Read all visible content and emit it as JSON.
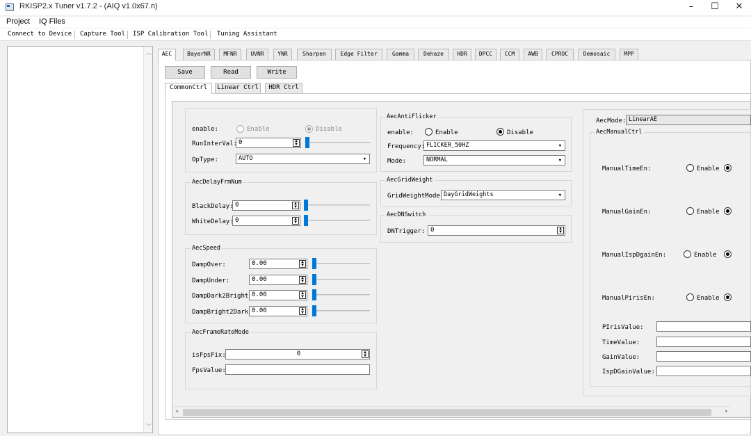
{
  "window": {
    "title": "RKISP2.x Tuner v1.7.2 - (AIQ v1.0x67.n)",
    "controls": [
      "–",
      "☐",
      "✕"
    ]
  },
  "menu": [
    "Project",
    "IQ Files"
  ],
  "toolbar": [
    "Connect to Device",
    "Capture Tool",
    "ISP Calibration Tool",
    "Tuning Assistant"
  ],
  "module_tabs": [
    "AEC",
    "BayerNR",
    "MFNR",
    "UVNR",
    "YNR",
    "Sharpen",
    "Edge Filter",
    "Gamma",
    "Dehaze",
    "HDR",
    "DPCC",
    "CCM",
    "AWB",
    "CPROC",
    "Demosaic",
    "MPP"
  ],
  "active_module_tab": "AEC",
  "actions": {
    "save": "Save",
    "read": "Read",
    "write": "Write"
  },
  "sub_tabs": [
    "CommonCtrl",
    "Linear Ctrl",
    "HDR Ctrl"
  ],
  "active_sub_tab": "CommonCtrl",
  "common": {
    "enable_label": "enable:",
    "enable_opt": "Enable",
    "disable_opt": "Disable",
    "runinterval_label": "RunInterVal:",
    "runinterval_value": "0",
    "optype_label": "OpType:",
    "optype_value": "AUTO"
  },
  "delay": {
    "title": "AecDelayFrmNum",
    "black_label": "BlackDelay:",
    "black_value": "0",
    "white_label": "WhiteDelay:",
    "white_value": "0"
  },
  "speed": {
    "title": "AecSpeed",
    "rows": [
      {
        "label": "DampOver:",
        "value": "0.00"
      },
      {
        "label": "DampUnder:",
        "value": "0.00"
      },
      {
        "label": "DampDark2Bright:",
        "value": "0.00"
      },
      {
        "label": "DampBright2Dark:",
        "value": "0.00"
      }
    ]
  },
  "framerate": {
    "title": "AecFrameRateMode",
    "isfpsfix_label": "isFpsFix:",
    "isfpsfix_value": "0",
    "fpsvalue_label": "FpsValue:",
    "fpsvalue_value": ""
  },
  "antiflicker": {
    "title": "AecAntiFlicker",
    "enable_label": "enable:",
    "enable_opt": "Enable",
    "disable_opt": "Disable",
    "freq_label": "Frequency:",
    "freq_value": "FLICKER_50HZ",
    "mode_label": "Mode:",
    "mode_value": "NORMAL"
  },
  "gridweight": {
    "title": "AecGridWeight",
    "label": "GridWeightMode:",
    "value": "DayGridWeights"
  },
  "dnswitch": {
    "title": "AecDNSwitch",
    "label": "DNTrigger:",
    "value": "0"
  },
  "right": {
    "aecmode_label": "AecMode:",
    "aecmode_value": "LinearAE",
    "manual_title": "AecManualCtrl",
    "enable_opt": "Enable",
    "manual_rows": [
      "ManualTimeEn:",
      "ManualGainEn:",
      "ManualIspDgainEn:",
      "ManualPirisEn:"
    ],
    "value_rows": [
      "PIrisValue:",
      "TimeValue:",
      "GainValue:",
      "IspDGainValue:"
    ]
  }
}
